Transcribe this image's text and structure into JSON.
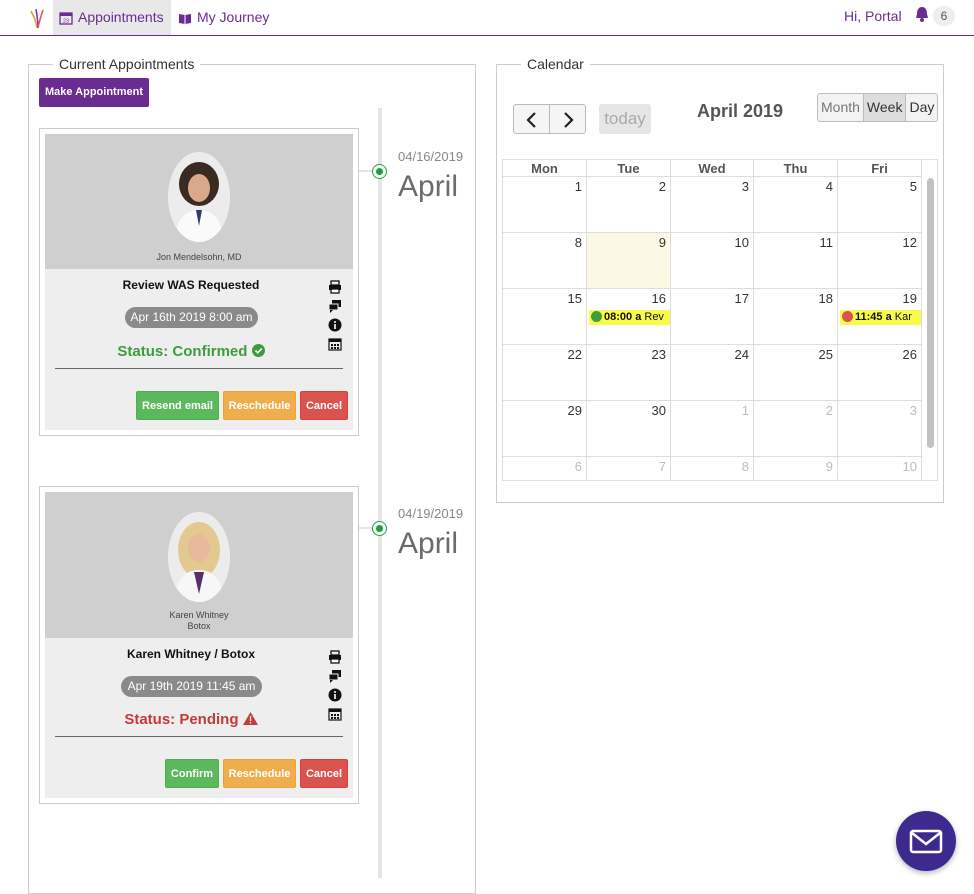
{
  "nav": {
    "appointments": "Appointments",
    "journey": "My Journey",
    "greeting": "Hi, Portal",
    "notification_count": "6"
  },
  "left_panel": {
    "legend": "Current Appointments",
    "make_button": "Make Appointment",
    "appointments": [
      {
        "timeline_date": "04/16/2019",
        "timeline_month": "April",
        "provider_line1": "Jon Mendelsohn, MD",
        "provider_line2": "",
        "title": "Review WAS Requested",
        "datetime": "Apr 16th 2019 8:00 am",
        "status": "Status: Confirmed",
        "buttons": [
          "Resend email",
          "Reschedule",
          "Cancel"
        ]
      },
      {
        "timeline_date": "04/19/2019",
        "timeline_month": "April",
        "provider_line1": "Karen Whitney",
        "provider_line2": "Botox",
        "title": "Karen Whitney / Botox",
        "datetime": "Apr 19th 2019 11:45 am",
        "status": "Status: Pending",
        "buttons": [
          "Confirm",
          "Reschedule",
          "Cancel"
        ]
      }
    ]
  },
  "calendar": {
    "legend": "Calendar",
    "title": "April 2019",
    "today_label": "today",
    "views": [
      "Month",
      "Week",
      "Day"
    ],
    "days": [
      "Mon",
      "Tue",
      "Wed",
      "Thu",
      "Fri"
    ],
    "weeks": [
      [
        "1",
        "2",
        "3",
        "4",
        "5"
      ],
      [
        "8",
        "9",
        "10",
        "11",
        "12"
      ],
      [
        "15",
        "16",
        "17",
        "18",
        "19"
      ],
      [
        "22",
        "23",
        "24",
        "25",
        "26"
      ],
      [
        "29",
        "30",
        "1",
        "2",
        "3"
      ],
      [
        "6",
        "7",
        "8",
        "9",
        "10"
      ]
    ],
    "events": [
      {
        "time": "08:00 a",
        "text": "Rev",
        "color": "#3e9b3e"
      },
      {
        "time": "11:45 a",
        "text": "Kar",
        "color": "#d9534f"
      }
    ]
  },
  "colors": {
    "brand": "#6a2c91",
    "confirmed": "#3e9b3e",
    "pending": "#c33b3b",
    "event_bg": "#fafa4b",
    "today_bg": "#fcf8e3"
  }
}
